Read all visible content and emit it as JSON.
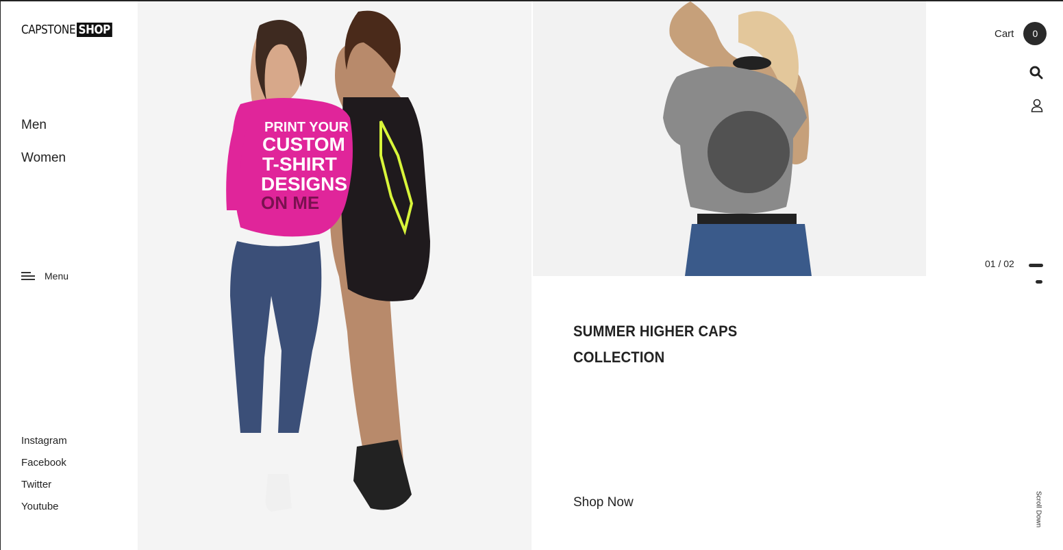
{
  "brand": {
    "name_part1": "CAPSTONE",
    "name_part2": "SHOP"
  },
  "nav": {
    "men": "Men",
    "women": "Women"
  },
  "menu": {
    "label": "Menu"
  },
  "social": [
    "Instagram",
    "Facebook",
    "Twitter",
    "Youtube"
  ],
  "hero_left": {
    "shirt_text": [
      "PRINT YOUR",
      "CUSTOM",
      "T-SHIRT",
      "DESIGNS",
      "ON ME"
    ]
  },
  "collection": {
    "title_line1": "SUMMER HIGHER CAPS",
    "title_line2": "COLLECTION",
    "cta": "Shop Now"
  },
  "header": {
    "cart_label": "Cart",
    "cart_count": "0"
  },
  "slider": {
    "pager": "01 / 02",
    "scroll_label": "Scroll Down"
  },
  "colors": {
    "accent_dark": "#2a2a2a",
    "hero_bg": "#f4f4f4",
    "pink_shirt": "#e0259a",
    "lime_print": "#d8f53a"
  }
}
